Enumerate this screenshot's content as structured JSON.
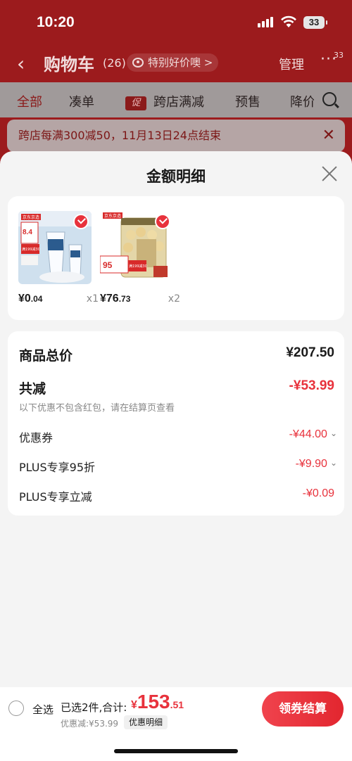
{
  "status": {
    "time": "10:20",
    "battery": "33"
  },
  "nav": {
    "title": "购物车",
    "count": "(26)",
    "pill": "特别好价噢 >",
    "manage": "管理",
    "badge": "33"
  },
  "tabs": [
    {
      "label": "全部"
    },
    {
      "label": "凑单"
    },
    {
      "tag": "促",
      "label": "跨店满减"
    },
    {
      "label": "预售"
    },
    {
      "label": "降价"
    }
  ],
  "notice": {
    "text": "跨店每满300减50，11月13日24点结束"
  },
  "sheet": {
    "title": "金额明细"
  },
  "products": [
    {
      "name": "toothpaste",
      "price_int": "¥0",
      "price_dec": ".04",
      "qty": "x1",
      "badge_price": "8.4",
      "promo": "满199减30"
    },
    {
      "name": "cashews",
      "price_int": "¥76",
      "price_dec": ".73",
      "qty": "x2",
      "badge_price": "95",
      "promo": "满199减30"
    }
  ],
  "summary": {
    "total_label": "商品总价",
    "total_value": "¥207.50",
    "reduce_label": "共减",
    "reduce_value": "-¥53.99",
    "note": "以下优惠不包含红包，请在结算页查看",
    "coupon_label": "优惠券",
    "coupon_value": "-¥44.00",
    "plus95_label": "PLUS专享95折",
    "plus95_value": "-¥9.90",
    "plusreduce_label": "PLUS专享立减",
    "plusreduce_value": "-¥0.09"
  },
  "bottom": {
    "select_all": "全选",
    "selected": "已选2件,合计:",
    "cur": "¥",
    "total_main": "153",
    "total_dec": ".51",
    "discount": "优惠减:¥53.99",
    "detail": "优惠明细",
    "checkout": "领券结算"
  },
  "colors": {
    "accent": "#e8323c",
    "header": "#9c1b1d"
  }
}
